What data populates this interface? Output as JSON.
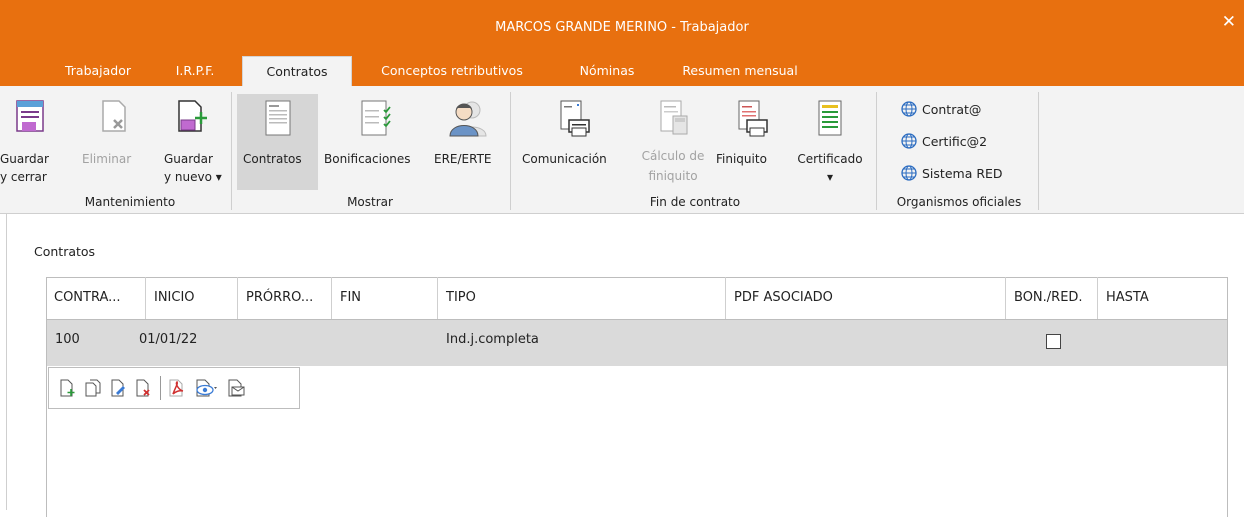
{
  "window": {
    "title": "MARCOS  GRANDE MERINO - Trabajador",
    "close_label": "✕"
  },
  "tabs": [
    {
      "label": "Trabajador"
    },
    {
      "label": "I.R.P.F."
    },
    {
      "label": "Contratos"
    },
    {
      "label": "Conceptos retributivos"
    },
    {
      "label": "Nóminas"
    },
    {
      "label": "Resumen mensual"
    }
  ],
  "ribbon": {
    "mantenimiento": {
      "label": "Mantenimiento",
      "guardar_cerrar": "Guardar\ny cerrar",
      "eliminar": "Eliminar",
      "guardar_nuevo": "Guardar\ny nuevo ▾"
    },
    "mostrar": {
      "label": "Mostrar",
      "contratos": "Contratos",
      "bonificaciones": "Bonificaciones",
      "ere_erte": "ERE/ERTE"
    },
    "fin_contrato": {
      "label": "Fin de contrato",
      "comunicacion": "Comunicación",
      "calculo": "Cálculo de\nfiniquito",
      "finiquito": "Finiquito",
      "certificado": "Certificado\n▾"
    },
    "organismos": {
      "label": "Organismos oficiales",
      "links": [
        "Contrat@",
        "Certific@2",
        "Sistema RED"
      ]
    }
  },
  "section_title": "Contratos",
  "table": {
    "columns": [
      "CONTRA...",
      "INICIO",
      "PRÓRRO...",
      "FIN",
      "TIPO",
      "PDF ASOCIADO",
      "BON./RED.",
      "HASTA"
    ],
    "rows": [
      {
        "contrato": "100",
        "inicio": "01/01/22",
        "prorroga": "",
        "fin": "",
        "tipo": "Ind.j.completa",
        "pdf": "",
        "bon_red": false,
        "hasta": ""
      }
    ]
  },
  "colors": {
    "accent": "#e8700f",
    "ribbon_bg": "#f3f3f3",
    "selected_row": "#dadada"
  }
}
